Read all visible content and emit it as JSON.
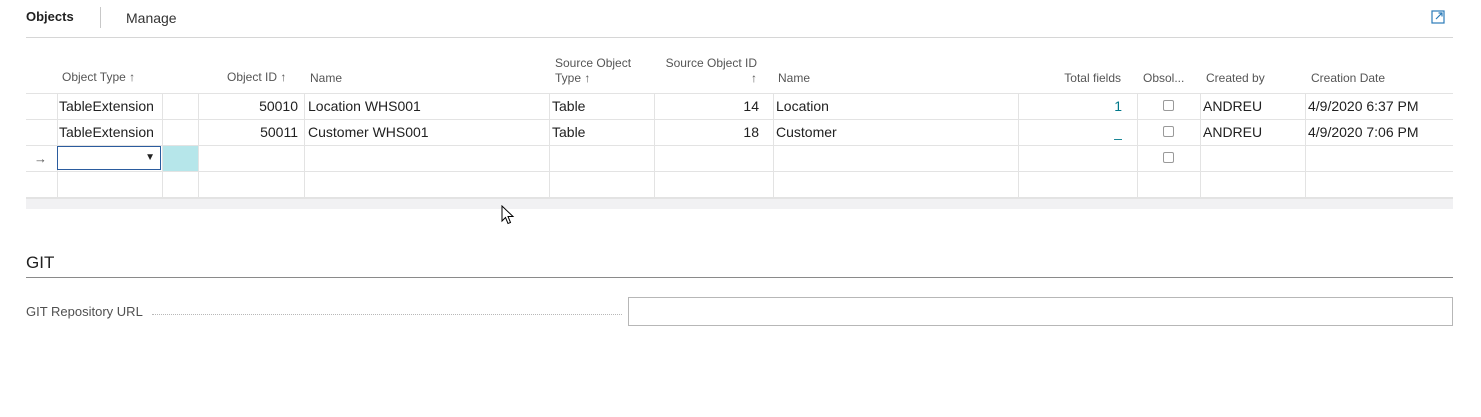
{
  "action_bar": {
    "tabs": [
      "Objects",
      "Manage"
    ],
    "expand_icon": "expand-icon"
  },
  "grid": {
    "headers": {
      "object_type": "Object Type ↑",
      "object_id": "Object ID ↑",
      "name": "Name",
      "source_object_type_line1": "Source Object",
      "source_object_type_line2": "Type ↑",
      "source_object_id_line1": "Source Object ID",
      "source_object_id_line2": "↑",
      "source_name": "Name",
      "total_fields": "Total fields",
      "obsolete": "Obsol...",
      "created_by": "Created by",
      "creation_date": "Creation Date"
    },
    "rows": [
      {
        "object_type": "TableExtension",
        "object_id": "50010",
        "name": "Location WHS001",
        "source_object_type": "Table",
        "source_object_id": "14",
        "source_name": "Location",
        "total_fields": "1",
        "obsolete": false,
        "created_by": "ANDREU",
        "creation_date": "4/9/2020 6:37 PM"
      },
      {
        "object_type": "TableExtension",
        "object_id": "50011",
        "name": "Customer WHS001",
        "source_object_type": "Table",
        "source_object_id": "18",
        "source_name": "Customer",
        "total_fields": "_",
        "obsolete": false,
        "created_by": "ANDREU",
        "creation_date": "4/9/2020 7:06 PM"
      }
    ],
    "new_row": {
      "indicator": "→",
      "caret": "▼",
      "obsolete": false
    }
  },
  "git": {
    "title": "GIT",
    "repo_label": "GIT Repository URL",
    "repo_value": ""
  },
  "colors": {
    "accent": "#00788a",
    "selection": "#b6e6ea",
    "focus_border": "#2b5c9e"
  }
}
